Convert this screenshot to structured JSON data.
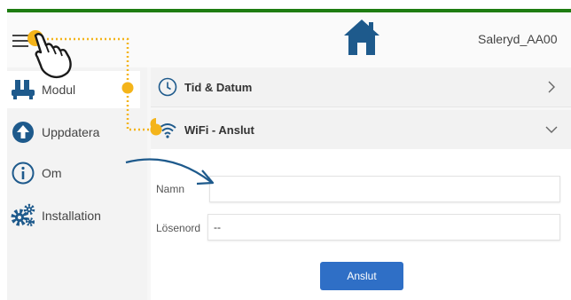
{
  "header": {
    "device_name": "Saleryd_AA00"
  },
  "sidebar": {
    "items": [
      {
        "label": "Modul",
        "icon": "vent-module-icon",
        "active": true
      },
      {
        "label": "Uppdatera",
        "icon": "arrow-up-circle-icon"
      },
      {
        "label": "Om",
        "icon": "info-circle-icon"
      },
      {
        "label": "Installation",
        "icon": "gears-icon"
      }
    ]
  },
  "sections": [
    {
      "label": "Tid & Datum",
      "icon": "clock-icon",
      "expanded": false
    },
    {
      "label": "WiFi - Anslut",
      "icon": "wifi-icon",
      "expanded": true
    }
  ],
  "wifi_form": {
    "name_label": "Namn",
    "name_value": "",
    "password_label": "Lösenord",
    "password_value": "--",
    "connect_label": "Anslut"
  },
  "colors": {
    "top_bar": "#1e7d12",
    "home_icon": "#1e5a8c",
    "primary_button": "#2f6fc6",
    "annotation_dot": "#f4b41a",
    "annotation_arrow": "#1e5a8c"
  }
}
